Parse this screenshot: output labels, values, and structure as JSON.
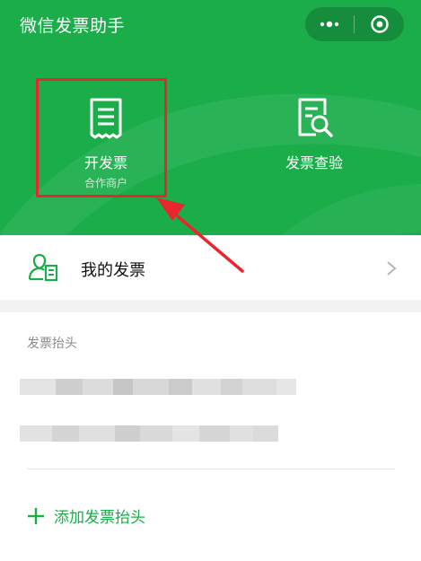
{
  "header": {
    "title": "微信发票助手",
    "more_icon": "more-dots-icon",
    "close_icon": "target-close-icon"
  },
  "tiles": [
    {
      "label": "开发票",
      "sublabel": "合作商户",
      "icon": "invoice-document-icon"
    },
    {
      "label": "发票查验",
      "icon": "invoice-search-icon"
    }
  ],
  "my_invoices": {
    "label": "我的发票",
    "icon": "person-invoice-icon",
    "chevron": "chevron-right-icon"
  },
  "invoice_titles": {
    "section_title": "发票抬头",
    "add_label": "添加发票抬头",
    "add_icon": "plus-icon"
  },
  "colors": {
    "brand_green": "#1aad4a",
    "highlight_red": "#e8262b"
  }
}
